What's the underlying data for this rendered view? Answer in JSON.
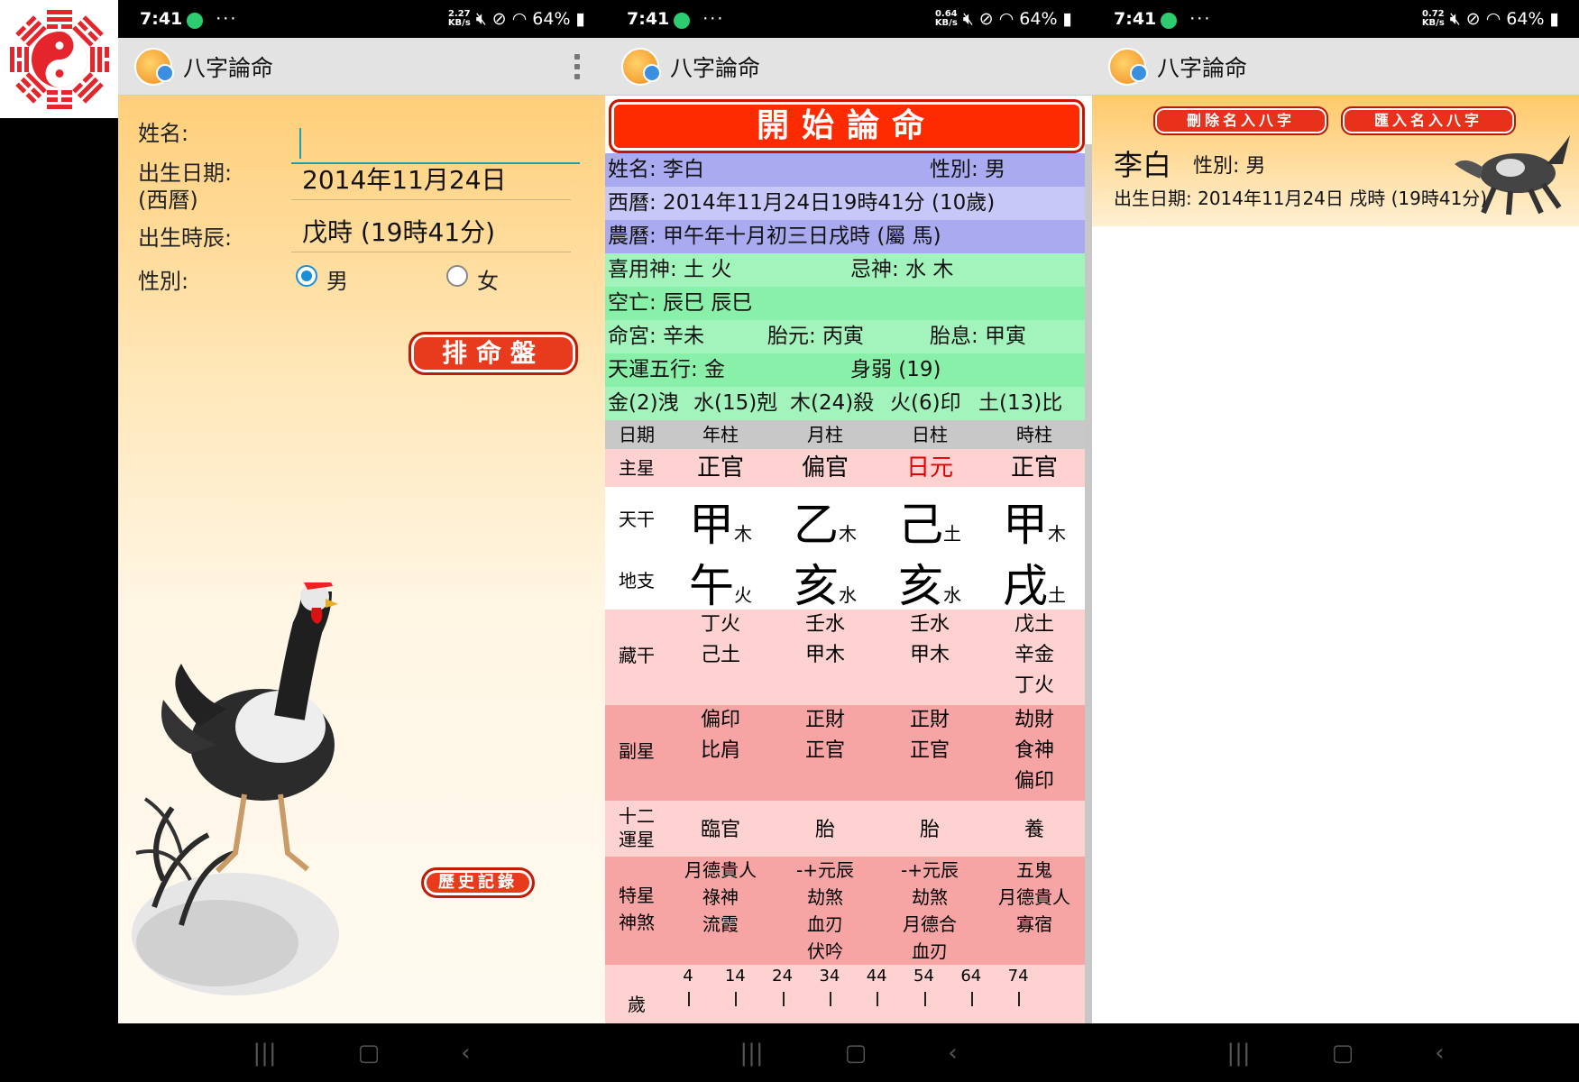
{
  "screens": [
    {
      "status": {
        "time": "7:41",
        "speed_top": "2.27",
        "speed_bottom": "KB/s",
        "battery": "64%"
      },
      "appbar": {
        "title": "八字論命"
      },
      "form": {
        "name_label": "姓名:",
        "name_value": "",
        "birthdate_label": "出生日期:",
        "birthdate_sub": "(西曆)",
        "birthdate_value": "2014年11月24日",
        "birthhour_label": "出生時辰:",
        "birthhour_value": "戊時 (19時41分)",
        "gender_label": "性別:",
        "male": "男",
        "female": "女",
        "male_selected": true,
        "submit": "排命盤",
        "history": "歷史記錄"
      }
    },
    {
      "status": {
        "time": "7:41",
        "speed_top": "0.64",
        "speed_bottom": "KB/s",
        "battery": "64%"
      },
      "appbar": {
        "title": "八字論命"
      },
      "banner": "開始論命",
      "info": {
        "name": "姓名: 李白",
        "gender": "性別: 男",
        "western": "西曆: 2014年11月24日19時41分 (10歲)",
        "lunar": "農曆: 甲午年十月初三日戌時 (屬 馬)",
        "favorable": "喜用神: 土 火",
        "avoid": "忌神: 水 木",
        "kongwang": "空亡: 辰巳 辰巳",
        "minggong": "命宮: 辛未",
        "taiyuan": "胎元: 丙寅",
        "taixi": "胎息: 甲寅",
        "tianyun": "天運五行: 金",
        "strength": "身弱 (19)",
        "elements": [
          "金(2)洩",
          "水(15)剋",
          "木(24)殺",
          "火(6)印",
          "土(13)比"
        ]
      },
      "table": {
        "header": [
          "日期",
          "年柱",
          "月柱",
          "日柱",
          "時柱"
        ],
        "zhuxing": {
          "label": "主星",
          "values": [
            "正官",
            "偏官",
            "日元",
            "正官"
          ]
        },
        "tiangan": {
          "label": "天干",
          "chars": [
            "甲",
            "乙",
            "己",
            "甲"
          ],
          "elems": [
            "木",
            "木",
            "土",
            "木"
          ]
        },
        "dizhi": {
          "label": "地支",
          "chars": [
            "午",
            "亥",
            "亥",
            "戌"
          ],
          "elems": [
            "火",
            "水",
            "水",
            "土"
          ]
        },
        "canggan": {
          "label": "藏干",
          "values": [
            [
              "丁火",
              "己土"
            ],
            [
              "壬水",
              "甲木"
            ],
            [
              "壬水",
              "甲木"
            ],
            [
              "戊土",
              "辛金",
              "丁火"
            ]
          ]
        },
        "fuxing": {
          "label": "副星",
          "values": [
            [
              "偏印",
              "比肩"
            ],
            [
              "正財",
              "正官"
            ],
            [
              "正財",
              "正官"
            ],
            [
              "劫財",
              "食神",
              "偏印"
            ]
          ]
        },
        "yunxing": {
          "label1": "十二",
          "label2": "運星",
          "values": [
            "臨官",
            "胎",
            "胎",
            "養"
          ]
        },
        "shensha": {
          "label1": "特星",
          "label2": "神煞",
          "values": [
            [
              "月德貴人",
              "祿神",
              "流霞"
            ],
            [
              "-+元辰",
              "劫煞",
              "血刃",
              "伏吟"
            ],
            [
              "-+元辰",
              "劫煞",
              "月德合",
              "血刃"
            ],
            [
              "五鬼",
              "月德貴人",
              "寡宿"
            ]
          ]
        },
        "age": {
          "label": "歲",
          "ticks": [
            "4",
            "14",
            "24",
            "34",
            "44",
            "54",
            "64",
            "74"
          ]
        }
      }
    },
    {
      "status": {
        "time": "7:41",
        "speed_top": "0.72",
        "speed_bottom": "KB/s",
        "battery": "64%"
      },
      "appbar": {
        "title": "八字論命"
      },
      "buttons": {
        "delete": "刪除名入八字",
        "import": "匯入名入八字"
      },
      "record": {
        "name": "李白",
        "gender": "性別: 男",
        "birth": "出生日期: 2014年11月24日 戌時 (19時41分)"
      }
    }
  ],
  "colors": {
    "accent_red": "#e83a1c",
    "teal": "#1aa0b0",
    "day_master": "#e00000"
  }
}
